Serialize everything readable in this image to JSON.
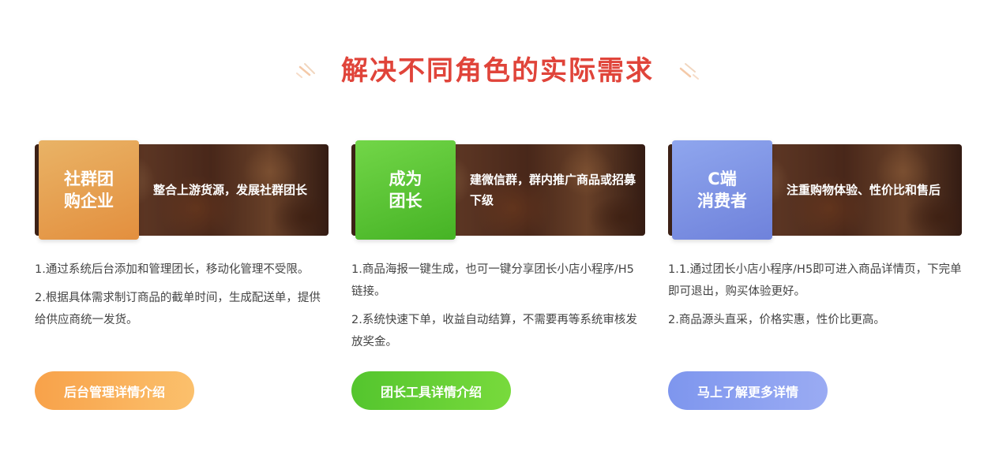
{
  "heading": {
    "title": "解决不同角色的实际需求"
  },
  "colors": {
    "heading": "#e0443a",
    "orange": "#e38f3e",
    "green": "#46b325",
    "blue": "#6f82db"
  },
  "cards": [
    {
      "tag_line1": "社群团",
      "tag_line2": "购企业",
      "banner_text": "整合上游货源，发展社群团长",
      "desc1": "1.通过系统后台添加和管理团长，移动化管理不受限。",
      "desc2": "2.根据具体需求制订商品的截单时间，生成配送单，提供给供应商统一发货。",
      "button": "后台管理详情介绍"
    },
    {
      "tag_line1": "成为",
      "tag_line2": "团长",
      "banner_text": "建微信群，群内推广商品或招募下级",
      "desc1": "1.商品海报一键生成，也可一键分享团长小店小程序/H5链接。",
      "desc2": "2.系统快速下单，收益自动结算，不需要再等系统审核发放奖金。",
      "button": "团长工具详情介绍"
    },
    {
      "tag_line1": "C端",
      "tag_line2": "消费者",
      "banner_text": "注重购物体验、性价比和售后",
      "desc1": "1.1.通过团长小店小程序/H5即可进入商品详情页，下完单即可退出，购买体验更好。",
      "desc2": "2.商品源头直采，价格实惠，性价比更高。",
      "button": "马上了解更多详情"
    }
  ]
}
